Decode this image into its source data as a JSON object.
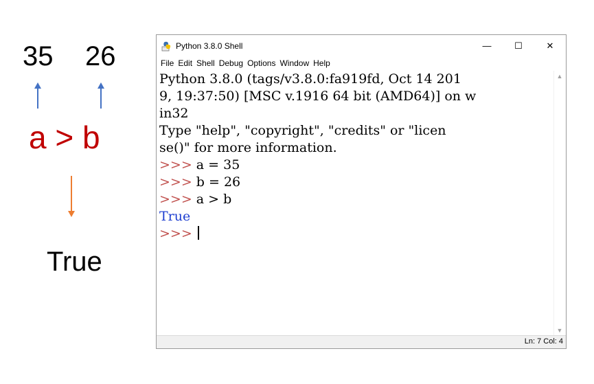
{
  "annotation": {
    "value_a": "35",
    "value_b": "26",
    "expression": "a > b",
    "result": "True",
    "colors": {
      "expression": "#c00000",
      "up_arrow": "#4472c4",
      "down_arrow": "#ed7d31"
    }
  },
  "window": {
    "title": "Python 3.8.0 Shell",
    "icon": "python-idle-icon",
    "controls": {
      "minimize": "—",
      "maximize": "☐",
      "close": "✕"
    },
    "menu": [
      "File",
      "Edit",
      "Shell",
      "Debug",
      "Options",
      "Window",
      "Help"
    ],
    "shell_lines": [
      {
        "prompt": "",
        "text": "Python 3.8.0 (tags/v3.8.0:fa919fd, Oct 14 201",
        "kind": "normal"
      },
      {
        "prompt": "",
        "text": "9, 19:37:50) [MSC v.1916 64 bit (AMD64)] on w",
        "kind": "normal"
      },
      {
        "prompt": "",
        "text": "in32",
        "kind": "normal"
      },
      {
        "prompt": "",
        "text": "Type \"help\", \"copyright\", \"credits\" or \"licen",
        "kind": "normal"
      },
      {
        "prompt": "",
        "text": "se()\" for more information.",
        "kind": "normal"
      },
      {
        "prompt": ">>>",
        "text": " a = 35",
        "kind": "normal"
      },
      {
        "prompt": ">>>",
        "text": " b = 26",
        "kind": "normal"
      },
      {
        "prompt": ">>>",
        "text": " a > b",
        "kind": "normal"
      },
      {
        "prompt": "",
        "text": "True",
        "kind": "output"
      },
      {
        "prompt": ">>>",
        "text": " ",
        "kind": "current"
      }
    ],
    "status": "Ln: 7  Col: 4",
    "colors": {
      "prompt": "#c0504d",
      "output": "#1f3fd0"
    }
  }
}
